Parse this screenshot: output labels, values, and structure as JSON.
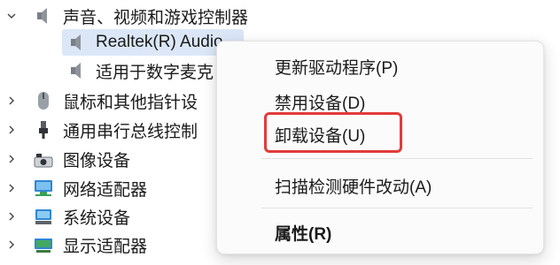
{
  "tree": {
    "items": [
      {
        "label": "声音、视频和游戏控制器",
        "icon": "speaker-icon",
        "expanded": true
      },
      {
        "label": "Realtek(R) Audio",
        "icon": "speaker-icon",
        "selected": true
      },
      {
        "label": "适用于数字麦克",
        "icon": "speaker-icon"
      },
      {
        "label": "鼠标和其他指针设",
        "icon": "mouse-icon",
        "expanded": false
      },
      {
        "label": "通用串行总线控制",
        "icon": "usb-icon",
        "expanded": false
      },
      {
        "label": "图像设备",
        "icon": "camera-icon",
        "expanded": false
      },
      {
        "label": "网络适配器",
        "icon": "network-icon",
        "expanded": false
      },
      {
        "label": "系统设备",
        "icon": "system-device-icon",
        "expanded": false
      },
      {
        "label": "显示适配器",
        "icon": "display-adapter-icon",
        "expanded": false
      }
    ]
  },
  "context_menu": {
    "update_driver": "更新驱动程序(P)",
    "disable_device": "禁用设备(D)",
    "uninstall_device": "卸载设备(U)",
    "scan_hardware": "扫描检测硬件改动(A)",
    "properties": "属性(R)"
  },
  "colors": {
    "highlight_box": "#e23b3b",
    "selection": "#dbe7f7",
    "accent": "#2b6cc4"
  }
}
